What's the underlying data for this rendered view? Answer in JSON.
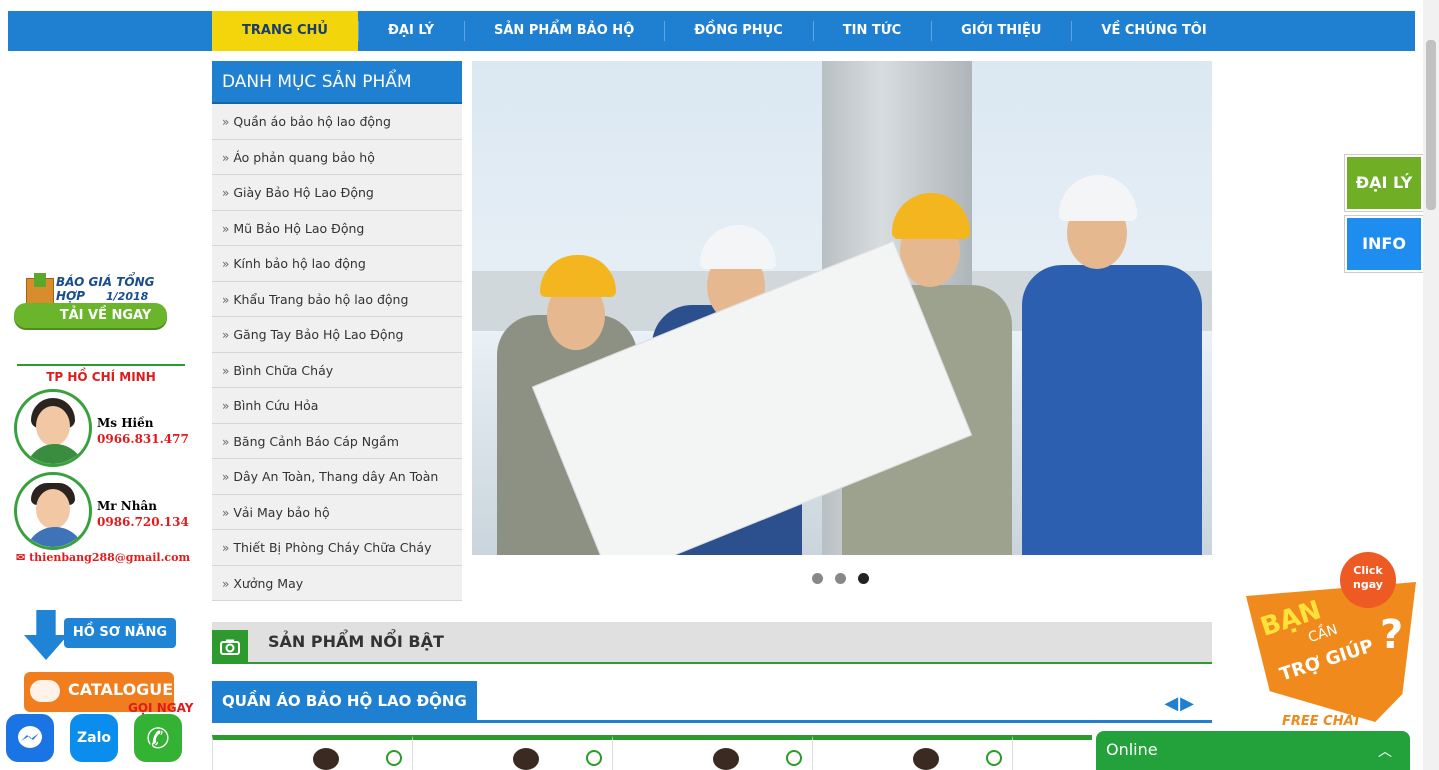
{
  "nav": {
    "items": [
      {
        "label": "TRANG CHỦ",
        "active": true
      },
      {
        "label": "ĐẠI LÝ"
      },
      {
        "label": "SẢN PHẨM BẢO HỘ"
      },
      {
        "label": "ĐỒNG PHỤC"
      },
      {
        "label": "TIN TỨC"
      },
      {
        "label": "GIỚI THIỆU"
      },
      {
        "label": "VỀ CHÚNG TÔI"
      }
    ]
  },
  "sidebar": {
    "price_banner": {
      "line1": "BÁO GIÁ TỔNG HỢP",
      "line2": "1/2018",
      "button": "TẢI VỀ NGAY"
    },
    "contact_title": "TP HỒ CHÍ MINH",
    "contacts": [
      {
        "name": "Ms Hiền",
        "phone": "0966.831.477"
      },
      {
        "name": "Mr Nhân",
        "phone": "0986.720.134"
      }
    ],
    "email": "thienbang288@gmail.com",
    "profile_button": "HỒ SƠ NĂNG LỰC",
    "catalogue_button": "CATALOGUE",
    "call_now": "GỌI NGAY",
    "social": {
      "zalo": "Zalo"
    }
  },
  "categories": {
    "title": "DANH MỤC SẢN PHẨM",
    "items": [
      "Quần áo bảo hộ lao động",
      "Áo phản quang bảo hộ",
      "Giày Bảo Hộ Lao Động",
      "Mũ Bảo Hộ Lao Động",
      "Kính bảo hộ lao động",
      "Khẩu Trang bảo hộ lao động",
      "Găng Tay Bảo Hộ Lao Động",
      "Bình Chữa Cháy",
      "Bình Cứu Hỏa",
      "Băng Cảnh Báo Cáp Ngầm",
      "Dây An Toàn, Thang dây An Toàn",
      "Vải May bảo hộ",
      "Thiết Bị Phòng Cháy Chữa Cháy",
      "Xưởng May"
    ]
  },
  "slider": {
    "slide_count": 3,
    "active_slide": 3
  },
  "featured": {
    "title": "SẢN PHẨM NỔI BẬT"
  },
  "section": {
    "title": "QUẦN ÁO BẢO HỘ LAO ĐỘNG"
  },
  "floating": {
    "agent": "ĐẠI LÝ",
    "info": "INFO"
  },
  "help": {
    "click": "Click",
    "now": "ngay",
    "line1": "BẠN",
    "line2": "CẦN",
    "line3": "TRỢ GIÚP",
    "free_chat": "FREE CHAT"
  },
  "chat": {
    "status": "Online"
  },
  "colors": {
    "primary": "#1f7fd0",
    "active_nav": "#f2d50a",
    "accent_green": "#2c9a2c",
    "hotline_red": "#e01b1b",
    "help_orange": "#f08a1c"
  }
}
